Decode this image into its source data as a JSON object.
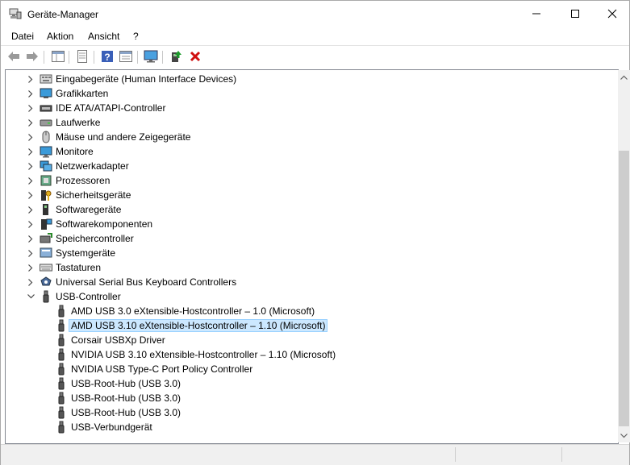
{
  "window": {
    "title": "Geräte-Manager"
  },
  "menu": [
    "Datei",
    "Aktion",
    "Ansicht",
    "?"
  ],
  "toolbar": [
    "back-arrow-icon",
    "forward-arrow-icon",
    "show-hide-tree-icon",
    "properties-icon",
    "help-icon",
    "view-icon",
    "monitor-icon",
    "update-driver-icon",
    "uninstall-device-icon"
  ],
  "tree": {
    "categories": [
      {
        "label": "Eingabegeräte (Human Interface Devices)",
        "icon": "hid-icon",
        "expanded": false
      },
      {
        "label": "Grafikkarten",
        "icon": "display-adapter-icon",
        "expanded": false
      },
      {
        "label": "IDE ATA/ATAPI-Controller",
        "icon": "ide-controller-icon",
        "expanded": false
      },
      {
        "label": "Laufwerke",
        "icon": "disk-drive-icon",
        "expanded": false
      },
      {
        "label": "Mäuse und andere Zeigegeräte",
        "icon": "mouse-icon",
        "expanded": false
      },
      {
        "label": "Monitore",
        "icon": "monitor-icon",
        "expanded": false
      },
      {
        "label": "Netzwerkadapter",
        "icon": "network-adapter-icon",
        "expanded": false
      },
      {
        "label": "Prozessoren",
        "icon": "processor-icon",
        "expanded": false
      },
      {
        "label": "Sicherheitsgeräte",
        "icon": "security-device-icon",
        "expanded": false
      },
      {
        "label": "Softwaregeräte",
        "icon": "software-device-icon",
        "expanded": false
      },
      {
        "label": "Softwarekomponenten",
        "icon": "software-component-icon",
        "expanded": false
      },
      {
        "label": "Speichercontroller",
        "icon": "storage-controller-icon",
        "expanded": false
      },
      {
        "label": "Systemgeräte",
        "icon": "system-device-icon",
        "expanded": false
      },
      {
        "label": "Tastaturen",
        "icon": "keyboard-icon",
        "expanded": false
      },
      {
        "label": "Universal Serial Bus Keyboard Controllers",
        "icon": "usb-keyboard-controller-icon",
        "expanded": false
      },
      {
        "label": "USB-Controller",
        "icon": "usb-controller-icon",
        "expanded": true
      }
    ],
    "usb_children": [
      {
        "label": "AMD USB 3.0 eXtensible-Hostcontroller – 1.0 (Microsoft)",
        "selected": false
      },
      {
        "label": "AMD USB 3.10 eXtensible-Hostcontroller – 1.10 (Microsoft)",
        "selected": true
      },
      {
        "label": "Corsair USBXp Driver",
        "selected": false
      },
      {
        "label": "NVIDIA USB 3.10 eXtensible-Hostcontroller – 1.10 (Microsoft)",
        "selected": false
      },
      {
        "label": "NVIDIA USB Type-C Port Policy Controller",
        "selected": false
      },
      {
        "label": "USB-Root-Hub (USB 3.0)",
        "selected": false
      },
      {
        "label": "USB-Root-Hub (USB 3.0)",
        "selected": false
      },
      {
        "label": "USB-Root-Hub (USB 3.0)",
        "selected": false
      },
      {
        "label": "USB-Verbundgerät",
        "selected": false
      }
    ]
  },
  "colors": {
    "selection_bg": "#cce8ff",
    "selection_border": "#99d1ff",
    "uninstall_red": "#d01010",
    "update_green": "#1a9a2a"
  }
}
